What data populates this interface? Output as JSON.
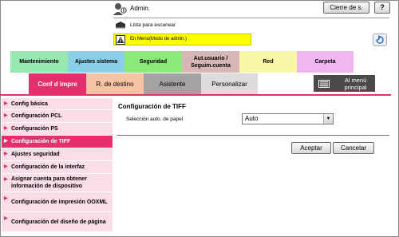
{
  "header": {
    "user_label": "Admin.",
    "logout_label": "Cierre de s.",
    "help_label": "?",
    "scan_list_label": "Lista para escanear",
    "mode_label": "En Menú(Modo de admin.)"
  },
  "tabs": [
    {
      "label": "Mantenimiento",
      "color": "#98e6b0"
    },
    {
      "label": "Ajustes sistema",
      "color": "#8ccde8"
    },
    {
      "label": "Seguridad",
      "color": "#8de87a"
    },
    {
      "label": "Aut.usuario / Seguim.cuenta",
      "color": "#d6b6b6"
    },
    {
      "label": "Red",
      "color": "#f8f8a6"
    },
    {
      "label": "Carpeta",
      "color": "#f0b6f0"
    }
  ],
  "subtabs": [
    {
      "label": "Conf d impre",
      "color": "#e3306a",
      "active": true
    },
    {
      "label": "R. de destino",
      "color": "#f7c3a5"
    },
    {
      "label": "Asistente",
      "color": "#a3a3a3"
    },
    {
      "label": "Personalizar",
      "color": "#dcdcdc"
    }
  ],
  "menu_main_label": "Al menú principal",
  "sidebar": {
    "items": [
      {
        "label": "Config básica"
      },
      {
        "label": "Configuración PCL"
      },
      {
        "label": "Configuración PS"
      },
      {
        "label": "Configuración de TIFF",
        "active": true
      },
      {
        "label": "Ajustes seguridad"
      },
      {
        "label": "Configuración de la interfaz"
      },
      {
        "label": "Asignar cuenta para obtener información de dispositivo"
      },
      {
        "label": "Configuración de impresión OOXML"
      },
      {
        "label": "Configuración del diseño de página"
      }
    ]
  },
  "main": {
    "title": "Configuración de TIFF",
    "paper_select_label": "Selección auto. de papel",
    "paper_select_value": "Auto",
    "accept_label": "Aceptar",
    "cancel_label": "Cancelar"
  }
}
